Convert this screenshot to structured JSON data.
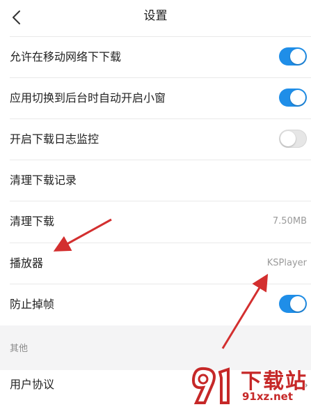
{
  "header": {
    "title": "设置"
  },
  "settings": {
    "allow_mobile_download": {
      "label": "允许在移动网络下下载",
      "toggle": "on"
    },
    "auto_pip": {
      "label": "应用切换到后台时自动开启小窗",
      "toggle": "on"
    },
    "download_log_monitor": {
      "label": "开启下载日志监控",
      "toggle": "off"
    },
    "clear_download_history": {
      "label": "清理下载记录"
    },
    "clear_downloads": {
      "label": "清理下载",
      "value": "7.50MB"
    },
    "player": {
      "label": "播放器",
      "value": "KSPlayer"
    },
    "prevent_frame_drop": {
      "label": "防止掉帧",
      "toggle": "on"
    }
  },
  "section_other": {
    "label": "其他",
    "items": [
      {
        "label": "用户协议"
      }
    ]
  },
  "watermark": {
    "main": "下载站",
    "sub": "91xz.net"
  },
  "colors": {
    "accent": "#1f8ee8",
    "annotation_arrow": "#d32f2f",
    "watermark": "#c62828"
  },
  "icons": {
    "back": "chevron-left-icon",
    "row_arrow": "chevron-right-icon"
  }
}
